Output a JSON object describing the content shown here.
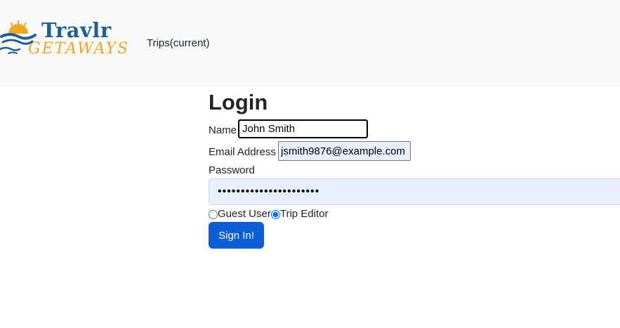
{
  "brand": {
    "name_line1": "Travlr",
    "name_line2": "GETAWAYS",
    "logo_icon": "sun-waves-birds-icon",
    "colors": {
      "blue": "#1f5f96",
      "orange": "#f2a51f"
    }
  },
  "nav": {
    "trips_link": "Trips(current)"
  },
  "login": {
    "title": "Login",
    "name_label": "Name",
    "name_value": "John Smith",
    "email_label": "Email Address",
    "email_value": "jsmith9876@example.com",
    "password_label": "Password",
    "password_value": "••••••••••••••••••••••",
    "role_options": [
      {
        "label": "Guest User",
        "checked": false
      },
      {
        "label": "Trip Editor",
        "checked": true
      }
    ],
    "submit_label": "Sign In!",
    "button_color": "#0b5ed7"
  }
}
